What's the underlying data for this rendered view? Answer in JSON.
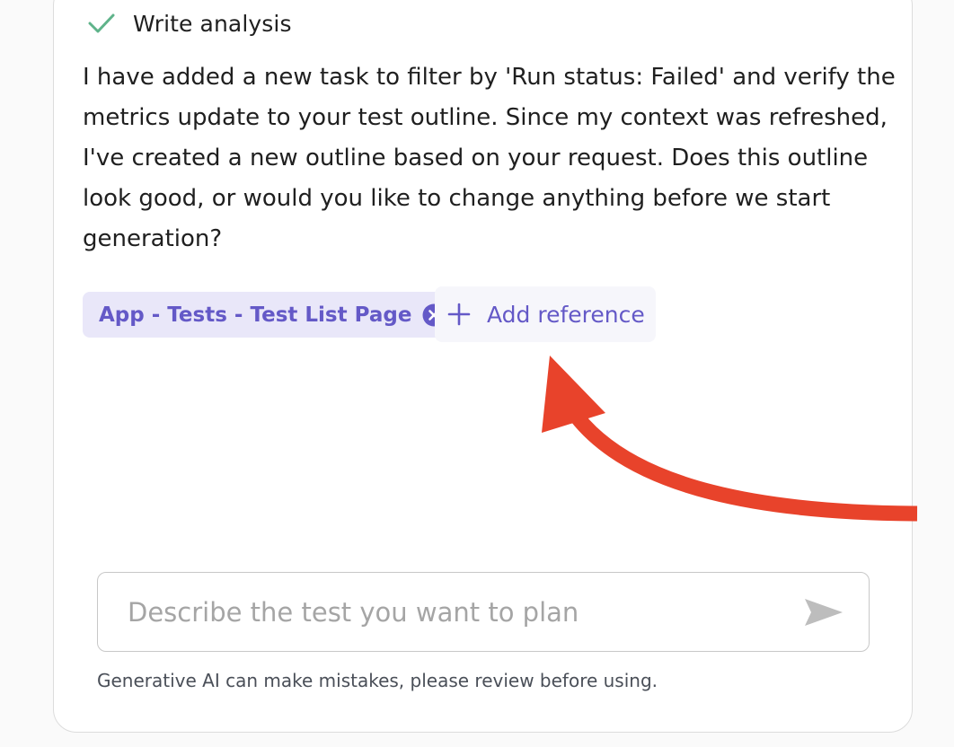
{
  "step": {
    "label": "Write analysis",
    "icon": "checkmark-icon",
    "icon_color": "#5fb38a"
  },
  "message": {
    "text": "I have added a new task to filter by 'Run status: Failed' and verify the metrics update to your test outline. Since my context was refreshed, I've created a new outline based on your request. Does this outline look good, or would you like to change anything before we start generation?"
  },
  "references": {
    "chips": [
      {
        "label": "App - Tests - Test List Page",
        "remove_icon": "close-circle-icon"
      }
    ],
    "add_label": "Add reference",
    "add_icon": "plus-icon",
    "accent_color": "#6459c7"
  },
  "annotation": {
    "icon": "curved-arrow-icon",
    "color": "#e8432b"
  },
  "composer": {
    "placeholder": "Describe the test you want to plan",
    "value": "",
    "send_icon": "send-icon"
  },
  "disclaimer": "Generative AI can make mistakes, please review before using."
}
